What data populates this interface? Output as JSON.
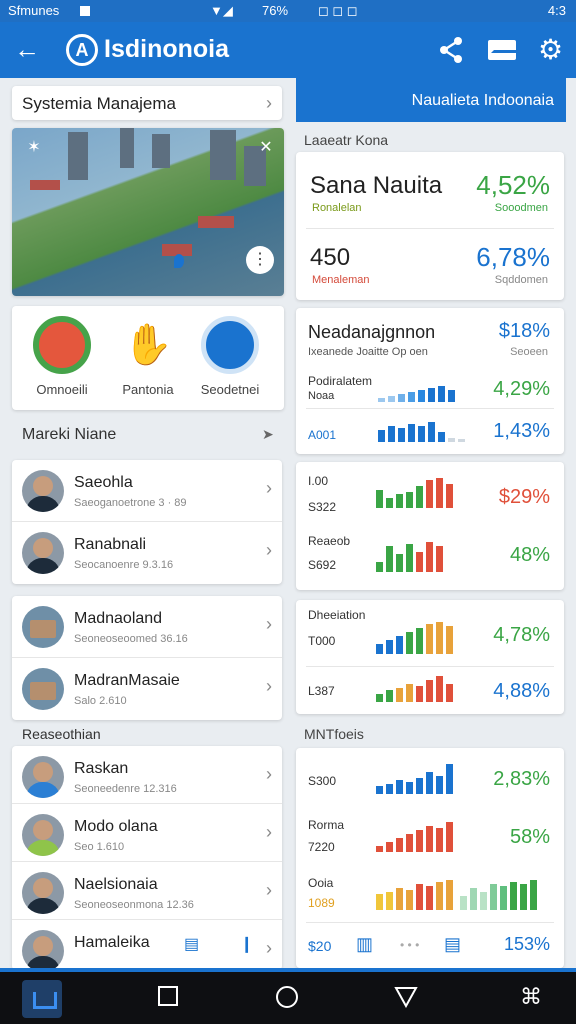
{
  "status": {
    "left": "Sfmunes",
    "mid": "76%",
    "right": "4:3"
  },
  "app": {
    "title": "Isdinonoia",
    "logo_letter": "A"
  },
  "search": {
    "text": "Systemia Manajema"
  },
  "apps": [
    {
      "label": "Omnoeili",
      "icon": "calendar-icon"
    },
    {
      "label": "Pantonia",
      "icon": "handshake-icon"
    },
    {
      "label": "Seodetnei",
      "icon": "group-icon"
    }
  ],
  "section1": {
    "title": "Mareki Niane"
  },
  "people_a": [
    {
      "name": "Saeohla",
      "sub": "Saeoganoetrone 3 · 89"
    },
    {
      "name": "Ranabnali",
      "sub": "Seocanoenre 9.3.16"
    }
  ],
  "people_b": [
    {
      "name": "Madnaoland",
      "sub": "Seoneoseoomed 36.16"
    },
    {
      "name": "MadranMasaie",
      "sub": "Salo 2.610"
    }
  ],
  "section2": {
    "title": "Reaseothian"
  },
  "people_c": [
    {
      "name": "Raskan",
      "sub": "Seoneedenre 12.316"
    },
    {
      "name": "Modo olana",
      "sub": "Seo 1.610"
    },
    {
      "name": "Naelsionaia",
      "sub": "Seoneoseonmona 12.36"
    },
    {
      "name": "Hamaleika",
      "sub": ""
    }
  ],
  "banner": {
    "text": "Naualieta  Indoonaia"
  },
  "right_head": "Laaeatr Kona",
  "stats": {
    "r1_title": "Sana Nauita",
    "r1_sub": "Ronalelan",
    "r1_val": "4,52%",
    "r1_valsub": "Sooodmen",
    "r2_title": "450",
    "r2_sub": "Menaleman",
    "r2_val": "6,78%",
    "r2_valsub": "Sqddomen"
  },
  "manage": {
    "title": "Neadanajgnnon",
    "sub": "Ixeanede Joaitte Op oen",
    "val": "$18%",
    "valsub": "Seoeen",
    "rows": [
      {
        "label": "Podiralatem",
        "label2": "Noaa",
        "pct": "4,29%",
        "color": "#3aa545"
      },
      {
        "label": "A001",
        "label2": "",
        "pct": "1,43%",
        "color": "#1a73cf"
      }
    ]
  },
  "charts": [
    {
      "label": "I.00",
      "label2": "S322",
      "pct": "$29%",
      "color": "#e0503a"
    },
    {
      "label": "Reaeob",
      "label2": "S692",
      "pct": "48%",
      "color": "#3aa545"
    },
    {
      "label": "Dheeiation",
      "label2": "T000",
      "pct": "4,78%",
      "color": "#3aa545"
    },
    {
      "label": "L387",
      "label2": "",
      "pct": "4,88%",
      "color": "#1a73cf"
    }
  ],
  "section3": {
    "title": "MNTfoeis"
  },
  "charts2": [
    {
      "label": "S300",
      "pct": "2,83%",
      "color": "#3aa545"
    },
    {
      "label": "Rorma",
      "label2": "7220",
      "pct": "58%",
      "color": "#3aa545"
    },
    {
      "label": "Ooia",
      "label2": "1089",
      "pct": "",
      "color": "#333"
    },
    {
      "label": "$20",
      "pct": "153%",
      "color": "#1a73cf"
    }
  ]
}
